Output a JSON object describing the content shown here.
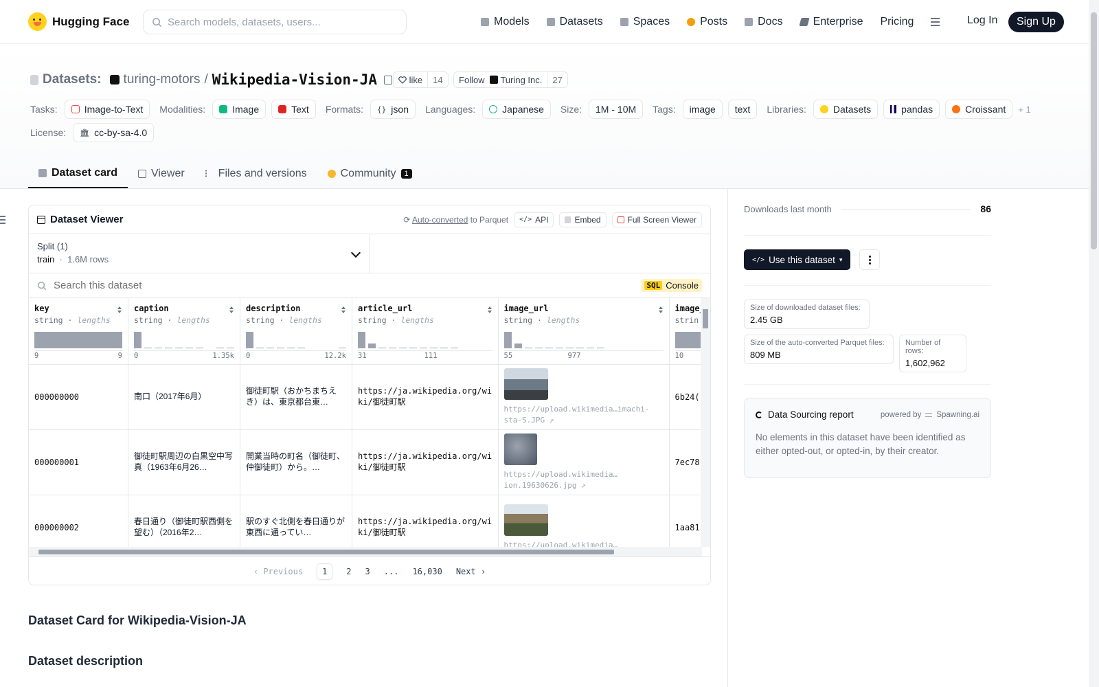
{
  "brand": {
    "name": "Hugging Face"
  },
  "search": {
    "placeholder": "Search models, datasets, users..."
  },
  "nav": {
    "items": [
      {
        "label": "Models",
        "icon": "cube-icon"
      },
      {
        "label": "Datasets",
        "icon": "database-icon"
      },
      {
        "label": "Spaces",
        "icon": "grid-icon"
      },
      {
        "label": "Posts",
        "icon": "posts-icon"
      },
      {
        "label": "Docs",
        "icon": "docs-icon"
      },
      {
        "label": "Enterprise",
        "icon": "enterprise-icon"
      },
      {
        "label": "Pricing"
      }
    ],
    "login": "Log In",
    "signup": "Sign Up"
  },
  "repo": {
    "section": "Datasets:",
    "org": "turing-motors",
    "slash": "/",
    "name": "Wikipedia-Vision-JA",
    "like_label": "like",
    "like_count": "14",
    "follow_label": "Follow",
    "follow_org": "Turing Inc.",
    "follow_count": "27"
  },
  "tags": {
    "tasks_label": "Tasks:",
    "task": "Image-to-Text",
    "modalities_label": "Modalities:",
    "modality_1": "Image",
    "modality_2": "Text",
    "formats_label": "Formats:",
    "format": "json",
    "languages_label": "Languages:",
    "language": "Japanese",
    "size_label": "Size:",
    "size": "1M - 10M",
    "tags_label": "Tags:",
    "tag_1": "image",
    "tag_2": "text",
    "libraries_label": "Libraries:",
    "lib_1": "Datasets",
    "lib_2": "pandas",
    "lib_3": "Croissant",
    "lib_more": "+ 1",
    "license_label": "License:",
    "license": "cc-by-sa-4.0"
  },
  "tabs": {
    "card": "Dataset card",
    "viewer": "Viewer",
    "files": "Files and versions",
    "community": "Community",
    "community_badge": "1"
  },
  "viewer": {
    "title": "Dataset Viewer",
    "auto_converted": "Auto-converted",
    "to_parquet": "to Parquet",
    "api": "API",
    "embed": "Embed",
    "fullscreen": "Full Screen Viewer",
    "split_label": "Split (1)",
    "split_name": "train",
    "split_dot": "·",
    "split_rows": "1.6M rows",
    "search_placeholder": "Search this dataset",
    "sql": "SQL",
    "console": "Console",
    "columns": [
      {
        "name": "key",
        "type": "string",
        "stat": "lengths",
        "min": "9",
        "max": "9"
      },
      {
        "name": "caption",
        "type": "string",
        "stat": "lengths",
        "min": "0",
        "max": "1.35k"
      },
      {
        "name": "description",
        "type": "string",
        "stat": "lengths",
        "min": "0",
        "max": "12.2k"
      },
      {
        "name": "article_url",
        "type": "string",
        "stat": "lengths",
        "min": "31",
        "max": "111"
      },
      {
        "name": "image_url",
        "type": "string",
        "stat": "lengths",
        "min": "55",
        "max": "977"
      },
      {
        "name": "image_",
        "type": "strin",
        "stat": "",
        "min": "10",
        "max": ""
      }
    ],
    "rows": [
      {
        "key": "000000000",
        "caption": "南口（2017年6月）",
        "description": "御徒町駅（おかちまちえき）は、東京都台東…",
        "article_url": "https://ja.wikipedia.org/wiki/御徒町駅",
        "image_url": "https://upload.wikimedia…imachi-sta-S.JPG ↗",
        "image_hash": "6b24("
      },
      {
        "key": "000000001",
        "caption": "御徒町駅周辺の白黒空中写真（1963年6月26…",
        "description": "開業当時の町名（御徒町、仲御徒町）から。…",
        "article_url": "https://ja.wikipedia.org/wiki/御徒町駅",
        "image_url": "https://upload.wikimedia…ion.19630626.jpg ↗",
        "image_hash": "7ec78"
      },
      {
        "key": "000000002",
        "caption": "春日通り（御徒町駅西側を望む）（2016年2…",
        "description": "駅のすぐ北側を春日通りが東西に通ってい…",
        "article_url": "https://ja.wikipedia.org/wiki/御徒町駅",
        "image_url": "https://upload.wikimedia…",
        "image_hash": "1aa81"
      }
    ],
    "pager": {
      "prev": "Previous",
      "p1": "1",
      "p2": "2",
      "p3": "3",
      "ellipsis": "...",
      "last": "16,030",
      "next": "Next"
    }
  },
  "card": {
    "heading": "Dataset Card for Wikipedia-Vision-JA",
    "subheading": "Dataset description"
  },
  "sidebar": {
    "downloads_label": "Downloads last month",
    "downloads": "86",
    "use_dataset": "Use this dataset",
    "size_dl_label": "Size of downloaded dataset files:",
    "size_dl": "2.45 GB",
    "size_parquet_label": "Size of the auto-converted Parquet files:",
    "size_parquet": "809 MB",
    "rows_label": "Number of rows:",
    "rows": "1,602,962",
    "report_title": "Data Sourcing report",
    "powered_by": "powered by",
    "spawning": "Spawning.ai",
    "report_text": "No elements in this dataset have been identified as either opted-out, or opted-in, by their creator."
  },
  "colors": {
    "accent": "#111827",
    "brand": "#ffd21e",
    "muted": "#6b7280"
  }
}
